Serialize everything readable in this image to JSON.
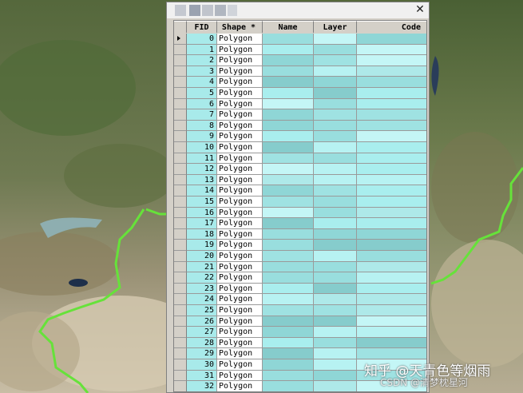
{
  "window": {
    "close_glyph": "✕"
  },
  "table": {
    "columns": [
      {
        "key": "fid",
        "label": "FID"
      },
      {
        "key": "shape",
        "label": "Shape *"
      },
      {
        "key": "name",
        "label": "Name"
      },
      {
        "key": "layer",
        "label": "Layer"
      },
      {
        "key": "code",
        "label": "Code"
      }
    ],
    "rows": [
      {
        "fid": "0",
        "shape": "Polygon"
      },
      {
        "fid": "1",
        "shape": "Polygon"
      },
      {
        "fid": "2",
        "shape": "Polygon"
      },
      {
        "fid": "3",
        "shape": "Polygon"
      },
      {
        "fid": "4",
        "shape": "Polygon"
      },
      {
        "fid": "5",
        "shape": "Polygon"
      },
      {
        "fid": "6",
        "shape": "Polygon"
      },
      {
        "fid": "7",
        "shape": "Polygon"
      },
      {
        "fid": "8",
        "shape": "Polygon"
      },
      {
        "fid": "9",
        "shape": "Polygon"
      },
      {
        "fid": "10",
        "shape": "Polygon"
      },
      {
        "fid": "11",
        "shape": "Polygon"
      },
      {
        "fid": "12",
        "shape": "Polygon"
      },
      {
        "fid": "13",
        "shape": "Polygon"
      },
      {
        "fid": "14",
        "shape": "Polygon"
      },
      {
        "fid": "15",
        "shape": "Polygon"
      },
      {
        "fid": "16",
        "shape": "Polygon"
      },
      {
        "fid": "17",
        "shape": "Polygon"
      },
      {
        "fid": "18",
        "shape": "Polygon"
      },
      {
        "fid": "19",
        "shape": "Polygon"
      },
      {
        "fid": "20",
        "shape": "Polygon"
      },
      {
        "fid": "21",
        "shape": "Polygon"
      },
      {
        "fid": "22",
        "shape": "Polygon"
      },
      {
        "fid": "23",
        "shape": "Polygon"
      },
      {
        "fid": "24",
        "shape": "Polygon"
      },
      {
        "fid": "25",
        "shape": "Polygon"
      },
      {
        "fid": "26",
        "shape": "Polygon"
      },
      {
        "fid": "27",
        "shape": "Polygon"
      },
      {
        "fid": "28",
        "shape": "Polygon"
      },
      {
        "fid": "29",
        "shape": "Polygon"
      },
      {
        "fid": "30",
        "shape": "Polygon"
      },
      {
        "fid": "31",
        "shape": "Polygon"
      },
      {
        "fid": "32",
        "shape": "Polygon"
      }
    ]
  },
  "watermark": {
    "line1": "知乎 @天青色等烟雨",
    "line2": "CSDN @清梦枕星河"
  },
  "colors": {
    "fid_cell": "#a8eaea",
    "border_line": "#66e23a"
  }
}
